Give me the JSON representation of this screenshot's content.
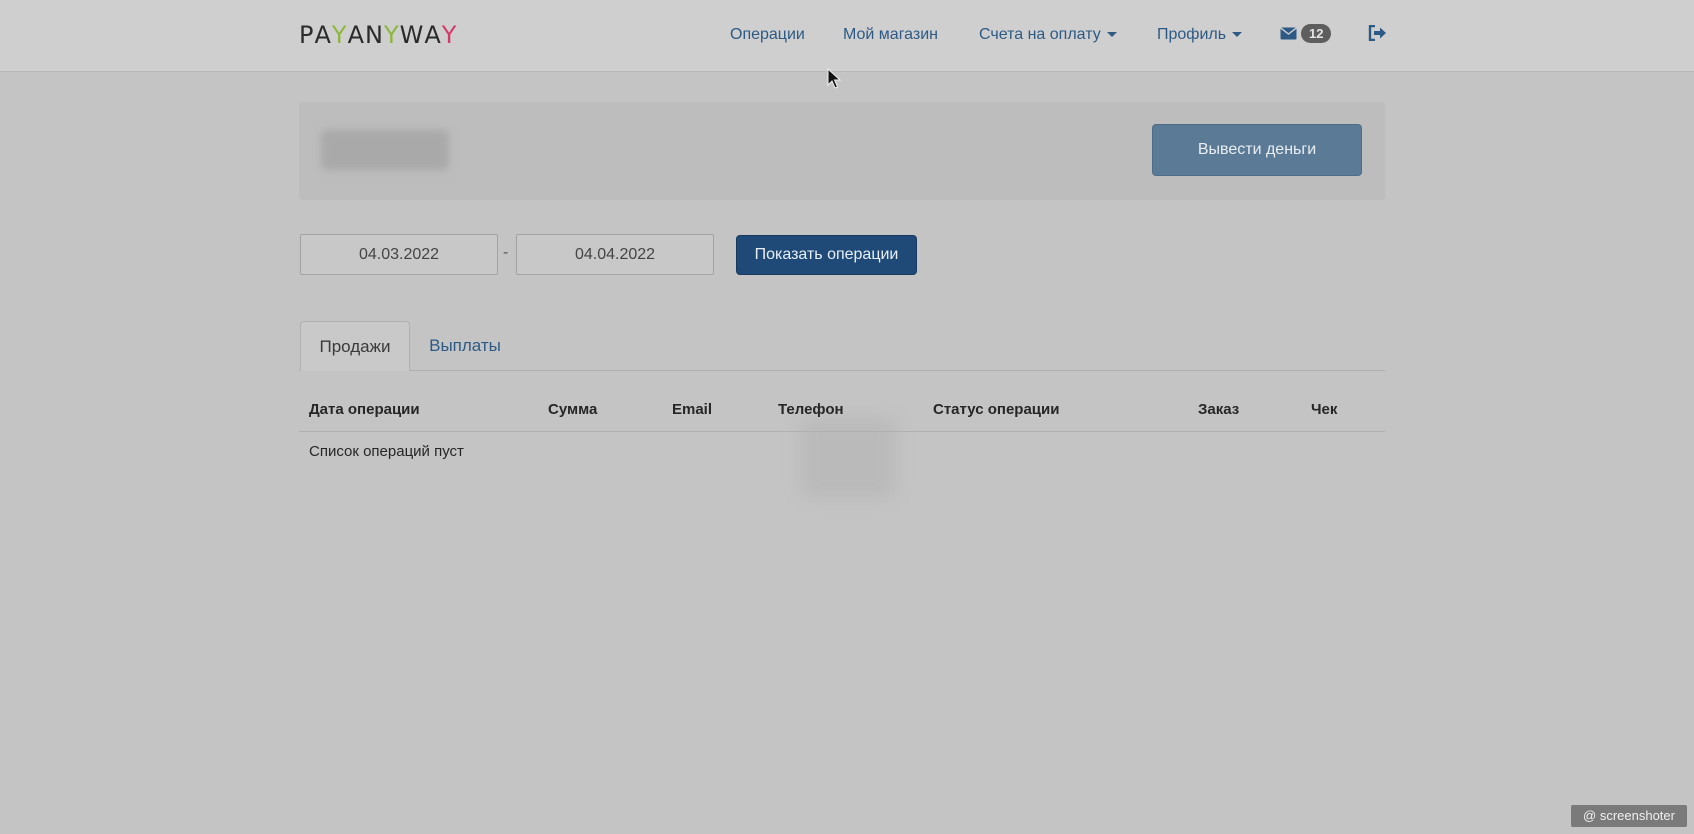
{
  "brand": {
    "letters": [
      "P",
      "A",
      "Y",
      "A",
      "N",
      "Y",
      "W",
      "A",
      "Y"
    ],
    "accent_y1": "#8fb63c",
    "accent_y2": "#d23a6a",
    "base_color": "#2b2b2b"
  },
  "nav": {
    "items": [
      {
        "label": "Операции"
      },
      {
        "label": "Мой магазин"
      },
      {
        "label": "Счета на оплату"
      },
      {
        "label": "Профиль"
      }
    ],
    "messages_count": "12",
    "icons": {
      "mail": "envelope-icon",
      "logout": "logout-icon"
    }
  },
  "balance": {
    "withdraw_label": "Вывести деньги"
  },
  "filter": {
    "date_from": "04.03.2022",
    "separator": "-",
    "date_to": "04.04.2022",
    "submit_label": "Показать операции"
  },
  "tabs": [
    {
      "label": "Продажи",
      "active": true
    },
    {
      "label": "Выплаты",
      "active": false
    }
  ],
  "table": {
    "columns": [
      "Дата операции",
      "Сумма",
      "Email",
      "Телефон",
      "Статус операции",
      "Заказ",
      "Чек"
    ],
    "empty_message": "Список операций пуст"
  },
  "watermark": "@ screenshoter",
  "colors": {
    "link": "#2d5a85",
    "primary_button": "#1f4a78",
    "withdraw_button": "#5b7a96"
  }
}
